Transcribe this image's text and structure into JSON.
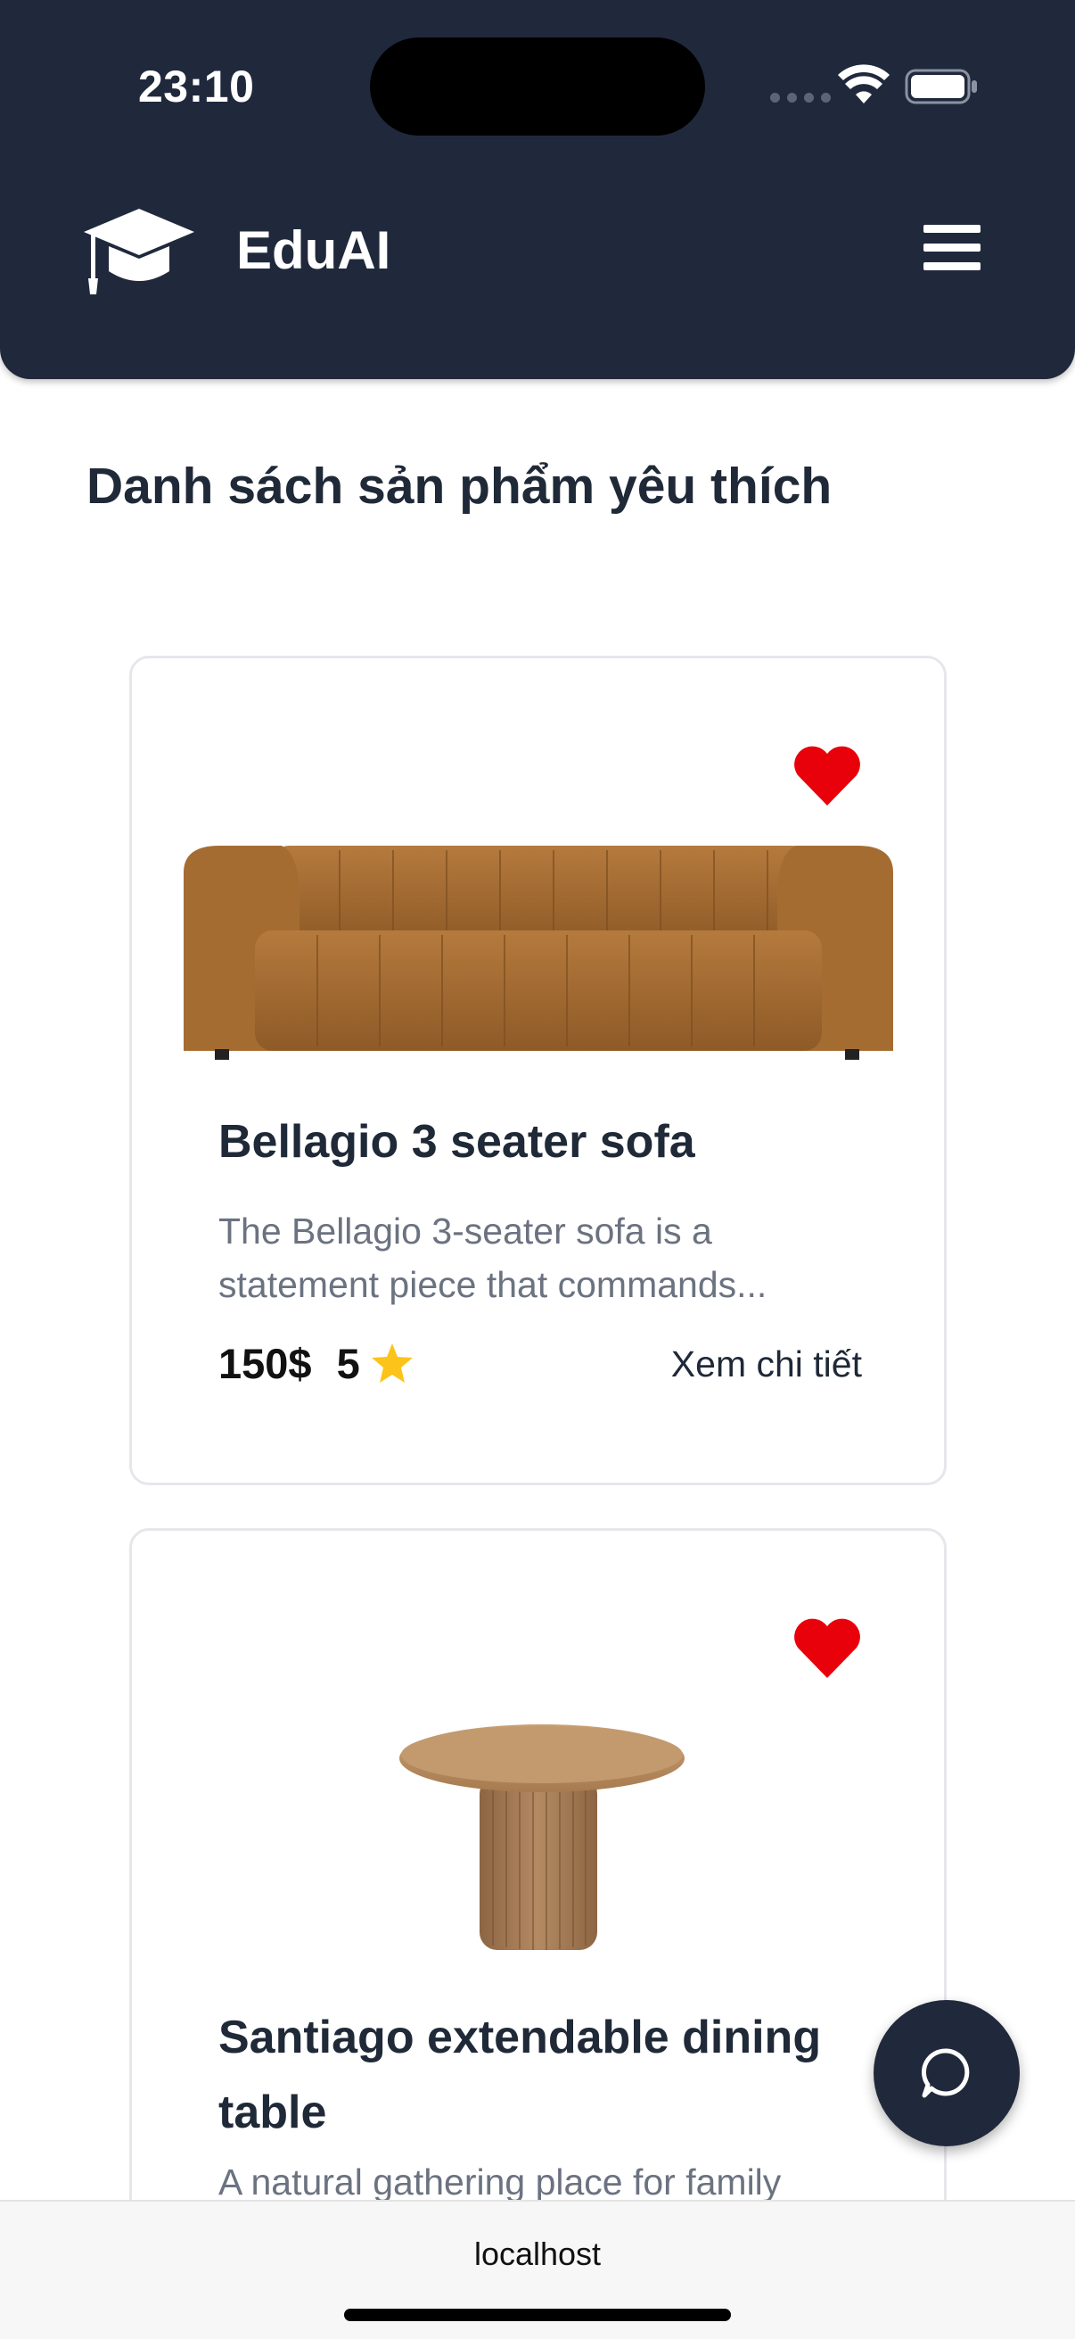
{
  "status_bar": {
    "time": "23:10"
  },
  "header": {
    "brand": "EduAI",
    "logo_icon": "graduation-cap-icon",
    "menu_icon": "hamburger-menu-icon",
    "background_color": "#20293c"
  },
  "page": {
    "title": "Danh sách sản phẩm yêu thích"
  },
  "products": [
    {
      "name": "Bellagio 3 seater sofa",
      "description": "The Bellagio 3-seater sofa is a statement piece that commands...",
      "price": "150$",
      "rating": "5",
      "details_label": "Xem chi tiết",
      "favorite": true,
      "image": "brown-velvet-sofa"
    },
    {
      "name": "Santiago extendable dining table",
      "description": "A natural gathering place for family",
      "favorite": true,
      "image": "round-wooden-pedestal-table"
    }
  ],
  "chat_button": {
    "icon": "chat-bubble-icon"
  },
  "browser": {
    "url": "localhost"
  },
  "colors": {
    "favorite_heart": "#e8000b",
    "star": "#fcc419",
    "title_text": "#1f2937",
    "muted_text": "#6b7280"
  }
}
